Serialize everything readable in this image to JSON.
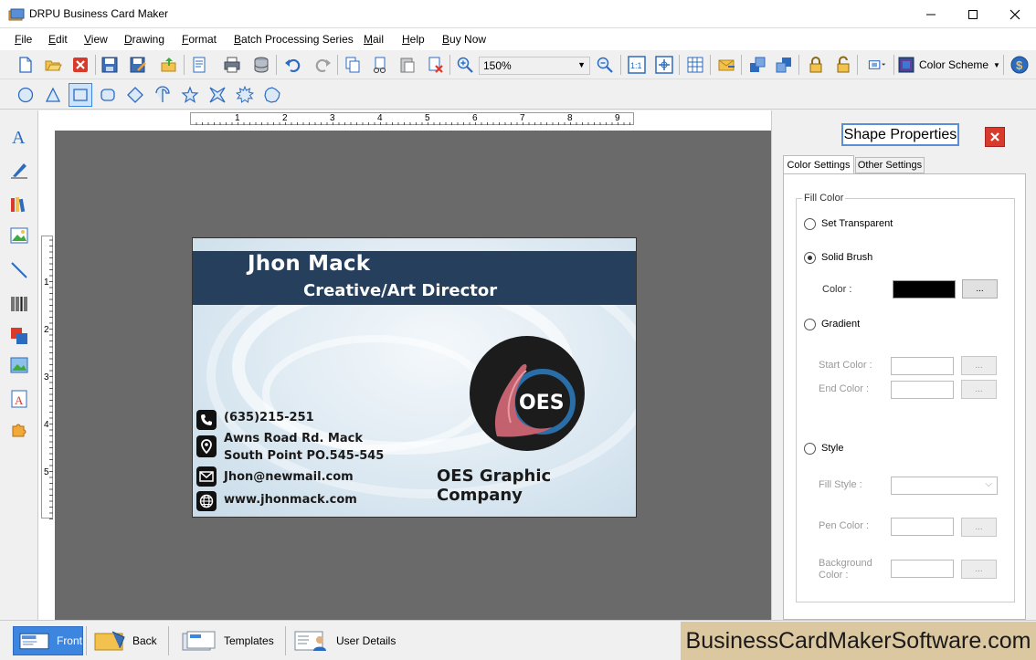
{
  "window": {
    "title": "DRPU Business Card Maker"
  },
  "menu": [
    "File",
    "Edit",
    "View",
    "Drawing",
    "Format",
    "Batch Processing Series",
    "Mail",
    "Help",
    "Buy Now"
  ],
  "toolbar": {
    "zoom_value": "150%",
    "color_scheme_label": "Color Scheme"
  },
  "card": {
    "name": "Jhon Mack",
    "role": "Creative/Art Director",
    "phone": "(635)215-251",
    "address_line1": "Awns Road Rd. Mack",
    "address_line2": "South Point PO.545-545",
    "email": "Jhon@newmail.com",
    "website": "www.jhonmack.com",
    "company": "OES Graphic Company",
    "logo_text": "OES"
  },
  "ruler": {
    "h_marks": [
      "1",
      "2",
      "3",
      "4",
      "5",
      "6",
      "7",
      "8",
      "9"
    ],
    "v_marks": [
      "1",
      "2",
      "3",
      "4",
      "5"
    ]
  },
  "panel": {
    "title": "Shape Properties",
    "tabs": [
      "Color Settings",
      "Other Settings"
    ],
    "group_label": "Fill Color",
    "opt_transparent": "Set Transparent",
    "opt_solid": "Solid Brush",
    "color_label": "Color :",
    "browse": "...",
    "opt_gradient": "Gradient",
    "start_color": "Start Color :",
    "end_color": "End Color :",
    "opt_style": "Style",
    "fill_style": "Fill Style :",
    "pen_color": "Pen Color :",
    "background_color_1": "Background",
    "background_color_2": "Color :",
    "solid_color": "#000000"
  },
  "bottom": {
    "front": "Front",
    "back": "Back",
    "templates": "Templates",
    "user_details": "User Details",
    "brand": "BusinessCardMakerSoftware.com"
  }
}
